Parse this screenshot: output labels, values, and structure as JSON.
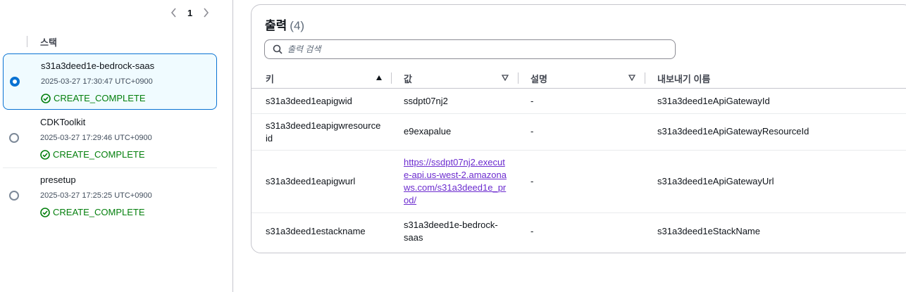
{
  "pagination": {
    "current_page": "1"
  },
  "stacks_panel": {
    "column_header": "스택",
    "stacks": [
      {
        "name": "s31a3deed1e-bedrock-saas",
        "timestamp": "2025-03-27 17:30:47 UTC+0900",
        "status": "CREATE_COMPLETE",
        "selected": true
      },
      {
        "name": "CDKToolkit",
        "timestamp": "2025-03-27 17:29:46 UTC+0900",
        "status": "CREATE_COMPLETE",
        "selected": false
      },
      {
        "name": "presetup",
        "timestamp": "2025-03-27 17:25:25 UTC+0900",
        "status": "CREATE_COMPLETE",
        "selected": false
      }
    ]
  },
  "outputs": {
    "title": "출력",
    "count": "(4)",
    "search_placeholder": "출력 검색",
    "columns": [
      "키",
      "값",
      "설명",
      "내보내기 이름"
    ],
    "rows": [
      {
        "key": "s31a3deed1eapigwid",
        "value": "ssdpt07nj2",
        "description": "-",
        "export_name": "s31a3deed1eApiGatewayId"
      },
      {
        "key": "s31a3deed1eapigwresource id",
        "value": "e9exapalue",
        "description": "-",
        "export_name": "s31a3deed1eApiGatewayResourceId"
      },
      {
        "key": "s31a3deed1eapigwurl",
        "value": "https://ssdpt07nj2.execute-api.us-west-2.amazonaws.com/s31a3deed1e_prod/",
        "description": "-",
        "export_name": "s31a3deed1eApiGatewayUrl"
      },
      {
        "key": "s31a3deed1estackname",
        "value": "s31a3deed1e-bedrock-saas",
        "description": "-",
        "export_name": "s31a3deed1eStackName"
      }
    ]
  },
  "colors": {
    "accent_blue": "#0972d3",
    "success_green": "#037f0c",
    "link_purple": "#6c2ccf",
    "selected_bg": "#f0fbff"
  }
}
